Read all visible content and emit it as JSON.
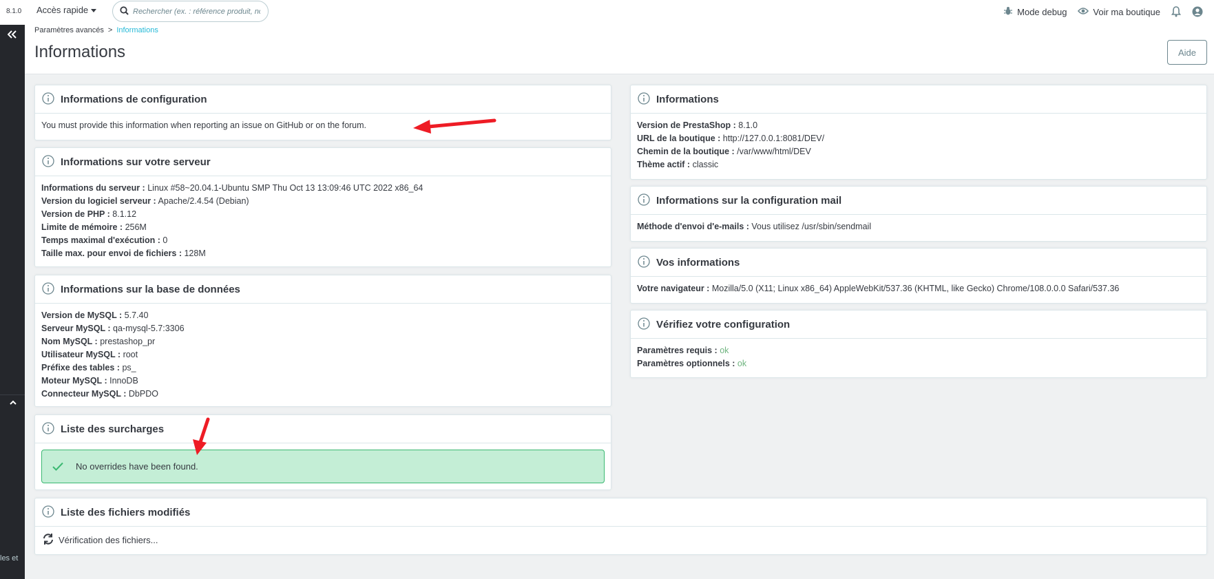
{
  "sidebar": {
    "version": "8.1.0",
    "footer_text": "les et"
  },
  "header": {
    "quick_access": "Accès rapide",
    "search_placeholder": "Rechercher (ex. : référence produit, no",
    "debug_mode": "Mode debug",
    "view_shop": "Voir ma boutique",
    "help": "Aide"
  },
  "breadcrumb": {
    "parent": "Paramètres avancés",
    "separator": ">",
    "current": "Informations"
  },
  "page_title": "Informations",
  "config_card": {
    "title": "Informations de configuration",
    "text": "You must provide this information when reporting an issue on GitHub or on the forum."
  },
  "server_card": {
    "title": "Informations sur votre serveur",
    "rows": [
      {
        "label": "Informations du serveur :",
        "value": "Linux #58~20.04.1-Ubuntu SMP Thu Oct 13 13:09:46 UTC 2022 x86_64"
      },
      {
        "label": "Version du logiciel serveur :",
        "value": "Apache/2.4.54 (Debian)"
      },
      {
        "label": "Version de PHP :",
        "value": "8.1.12"
      },
      {
        "label": "Limite de mémoire :",
        "value": "256M"
      },
      {
        "label": "Temps maximal d'exécution :",
        "value": "0"
      },
      {
        "label": "Taille max. pour envoi de fichiers :",
        "value": "128M"
      }
    ]
  },
  "db_card": {
    "title": "Informations sur la base de données",
    "rows": [
      {
        "label": "Version de MySQL :",
        "value": "5.7.40"
      },
      {
        "label": "Serveur MySQL :",
        "value": "qa-mysql-5.7:3306"
      },
      {
        "label": "Nom MySQL :",
        "value": "prestashop_pr"
      },
      {
        "label": "Utilisateur MySQL :",
        "value": "root"
      },
      {
        "label": "Préfixe des tables :",
        "value": "ps_"
      },
      {
        "label": "Moteur MySQL :",
        "value": "InnoDB"
      },
      {
        "label": "Connecteur MySQL :",
        "value": "DbPDO"
      }
    ]
  },
  "overrides_card": {
    "title": "Liste des surcharges",
    "message": "No overrides have been found."
  },
  "info_card": {
    "title": "Informations",
    "rows": [
      {
        "label": "Version de PrestaShop :",
        "value": "8.1.0"
      },
      {
        "label": "URL de la boutique :",
        "value": "http://127.0.0.1:8081/DEV/"
      },
      {
        "label": "Chemin de la boutique :",
        "value": "/var/www/html/DEV"
      },
      {
        "label": "Thème actif :",
        "value": "classic"
      }
    ]
  },
  "mail_card": {
    "title": "Informations sur la configuration mail",
    "rows": [
      {
        "label": "Méthode d'envoi d'e-mails :",
        "value": "Vous utilisez /usr/sbin/sendmail"
      }
    ]
  },
  "you_card": {
    "title": "Vos informations",
    "rows": [
      {
        "label": "Votre navigateur :",
        "value": "Mozilla/5.0 (X11; Linux x86_64) AppleWebKit/537.36 (KHTML, like Gecko) Chrome/108.0.0.0 Safari/537.36"
      }
    ]
  },
  "check_card": {
    "title": "Vérifiez votre configuration",
    "rows": [
      {
        "label": "Paramètres requis :",
        "value": "ok"
      },
      {
        "label": "Paramètres optionnels :",
        "value": "ok"
      }
    ]
  },
  "files_card": {
    "title": "Liste des fichiers modifiés",
    "text": "Vérification des fichiers..."
  },
  "colors": {
    "accent": "#25b9d7",
    "success_bg": "#c4eed6",
    "success_border": "#3ab871",
    "ok": "#70b580",
    "annotation": "#ee1c25"
  }
}
